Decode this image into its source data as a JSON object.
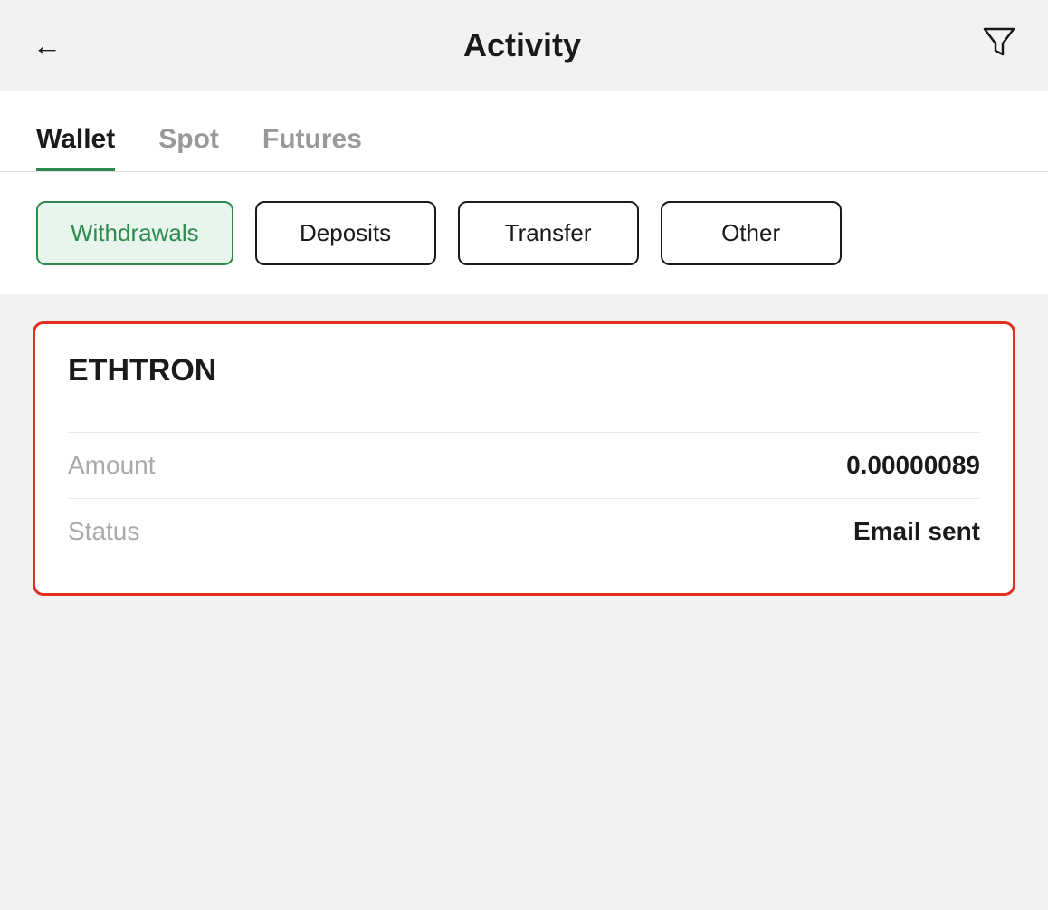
{
  "header": {
    "back_label": "←",
    "title": "Activity",
    "filter_icon": "▽"
  },
  "tabs": [
    {
      "id": "wallet",
      "label": "Wallet",
      "active": true
    },
    {
      "id": "spot",
      "label": "Spot",
      "active": false
    },
    {
      "id": "futures",
      "label": "Futures",
      "active": false
    }
  ],
  "filter_buttons": [
    {
      "id": "withdrawals",
      "label": "Withdrawals",
      "active": true
    },
    {
      "id": "deposits",
      "label": "Deposits",
      "active": false
    },
    {
      "id": "transfer",
      "label": "Transfer",
      "active": false
    },
    {
      "id": "other",
      "label": "Other",
      "active": false
    }
  ],
  "transaction_card": {
    "name": "ETHTRON",
    "amount_label": "Amount",
    "amount_value": "0.00000089",
    "status_label": "Status",
    "status_value": "Email sent"
  }
}
